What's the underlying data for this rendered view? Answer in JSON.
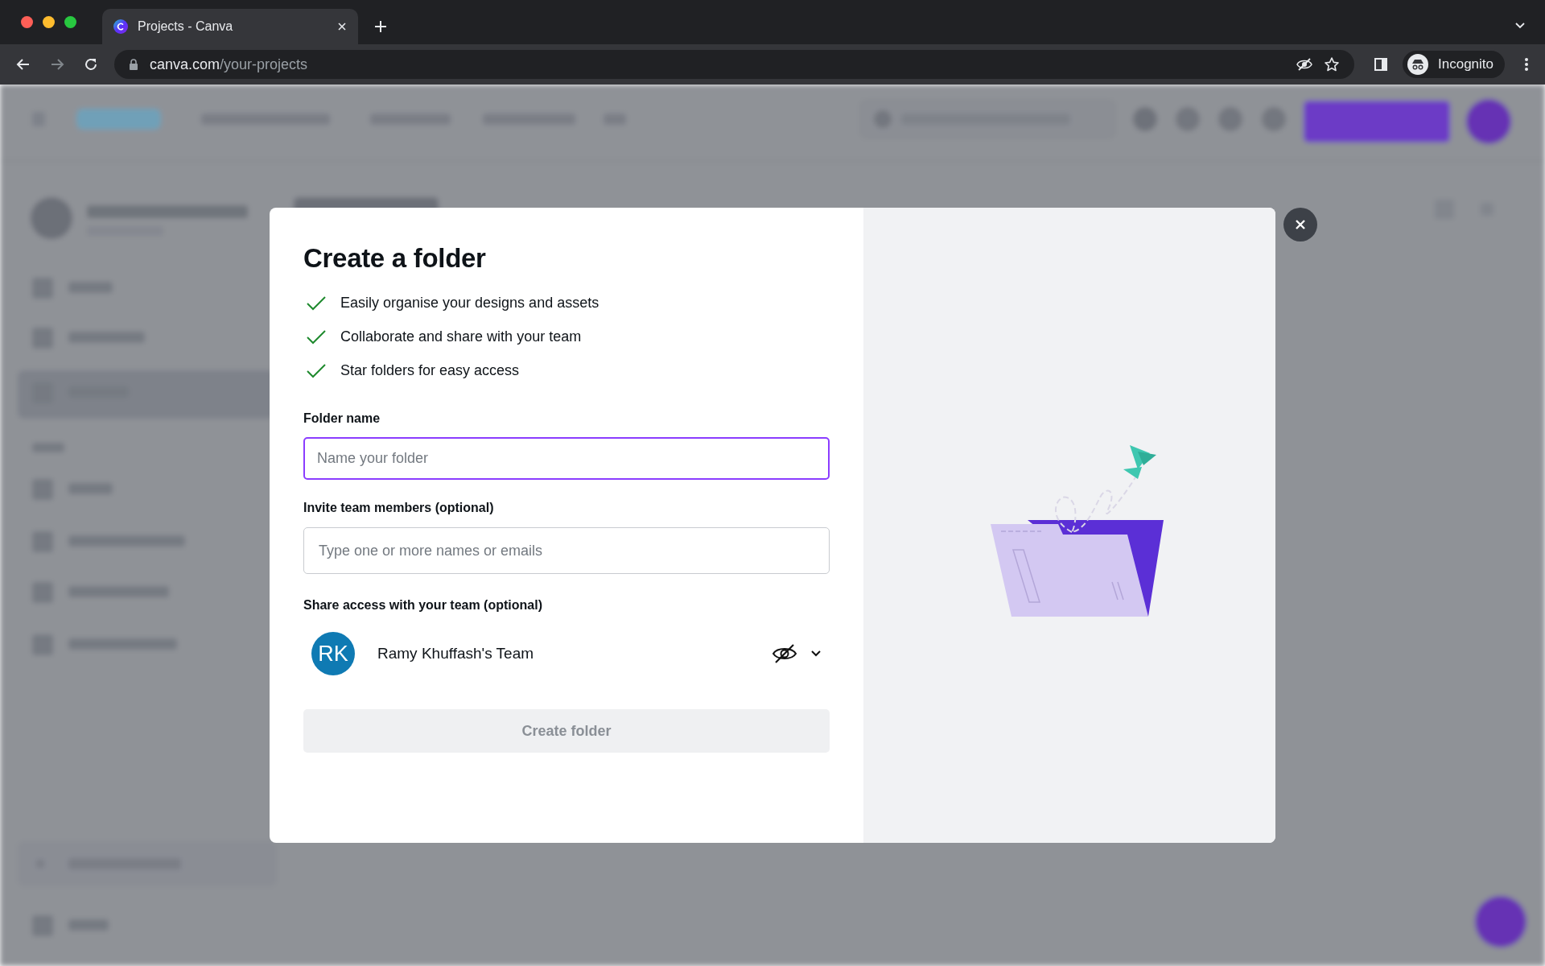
{
  "browser": {
    "tabs": [
      {
        "title": "Projects - Canva",
        "selected": true
      }
    ],
    "url": {
      "host": "canva.com",
      "path": "/your-projects"
    },
    "profile": "Incognito"
  },
  "dialog": {
    "title": "Create a folder",
    "benefits": [
      "Easily organise your designs and assets",
      "Collaborate and share with your team",
      "Star folders for easy access"
    ],
    "fields": [
      {
        "label": "Folder name",
        "placeholder": "Name your folder",
        "focused": true
      },
      {
        "label": "Invite team members (optional)",
        "placeholder": "Type one or more names or emails",
        "focused": false
      }
    ],
    "share": {
      "label": "Share access with your team (optional)",
      "team": {
        "initials": "RK",
        "name": "Ramy Khuffash's Team"
      }
    },
    "button": {
      "label": "Create folder",
      "disabled": true
    }
  }
}
